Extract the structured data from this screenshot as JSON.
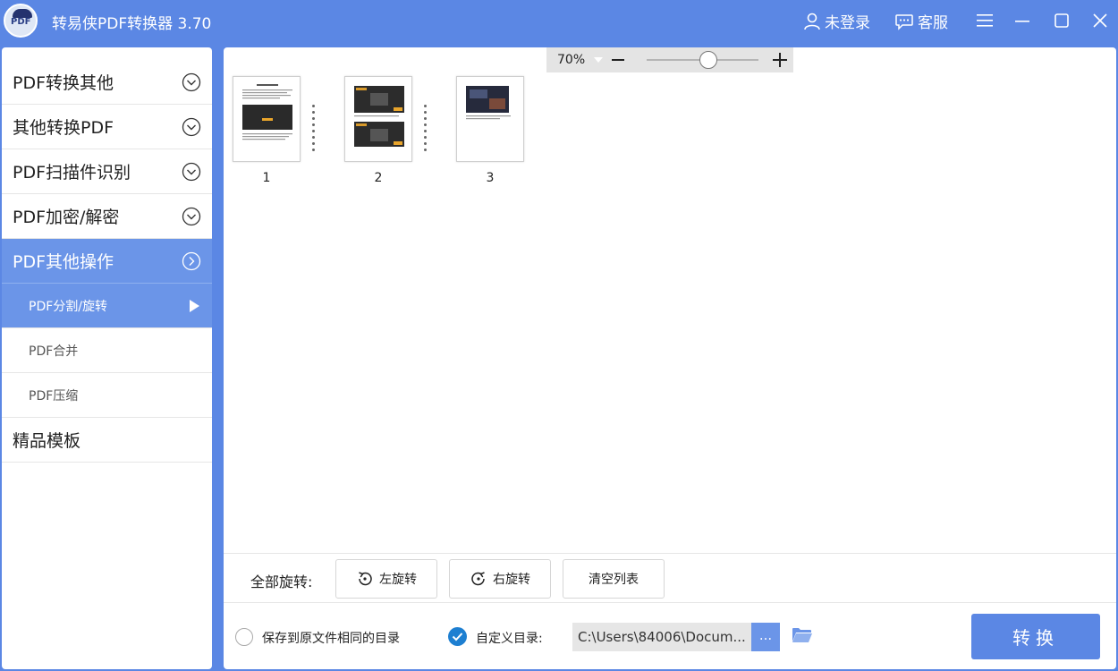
{
  "app": {
    "title": "转易侠PDF转换器 3.70"
  },
  "header": {
    "login_label": "未登录",
    "service_label": "客服"
  },
  "sidebar": {
    "items": [
      {
        "label": "PDF转换其他"
      },
      {
        "label": "其他转换PDF"
      },
      {
        "label": "PDF扫描件识别"
      },
      {
        "label": "PDF加密/解密"
      },
      {
        "label": "PDF其他操作"
      }
    ],
    "subitems": [
      {
        "label": "PDF分割/旋转"
      },
      {
        "label": "PDF合并"
      },
      {
        "label": "PDF压缩"
      }
    ],
    "templates_label": "精品模板"
  },
  "zoom": {
    "value": "70%",
    "level": 0.55
  },
  "pages": [
    {
      "number": "1"
    },
    {
      "number": "2"
    },
    {
      "number": "3"
    }
  ],
  "rotate": {
    "label": "全部旋转:",
    "left_label": "左旋转",
    "right_label": "右旋转",
    "clear_label": "清空列表"
  },
  "output": {
    "same_dir_label": "保存到原文件相同的目录",
    "custom_dir_label": "自定义目录:",
    "path_value": "C:\\Users\\84006\\Docum...",
    "browse_label": "...",
    "convert_label": "转换"
  },
  "colors": {
    "accent": "#5b87e4",
    "active_item": "#6b95e8",
    "check": "#1d7fd1"
  }
}
